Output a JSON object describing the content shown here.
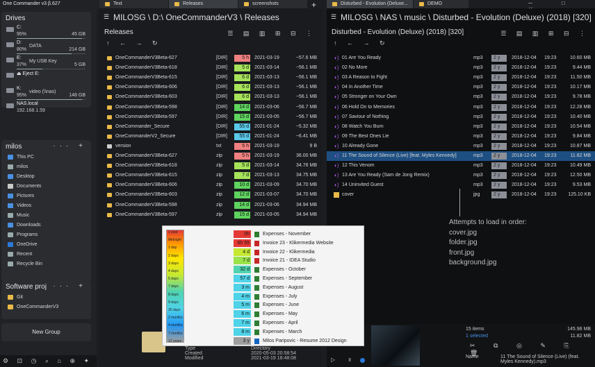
{
  "app": {
    "title": "One Commander v3 β.627"
  },
  "drives": {
    "title": "Drives",
    "items": [
      {
        "name": "C:",
        "pct": "95%",
        "label": "",
        "size": "45 GB",
        "fill": 0.95
      },
      {
        "name": "D:",
        "pct": "80%",
        "label": "DATA",
        "size": "214 GB",
        "fill": 0.8
      },
      {
        "name": "E:",
        "pct": "37%",
        "label": "My USB Key",
        "size": "5 GB",
        "fill": 0.37
      },
      {
        "name": "⏏ Eject E:",
        "pct": "",
        "label": "",
        "size": "",
        "fill": 0
      },
      {
        "name": "K:",
        "pct": "95%",
        "label": "video (\\\\nas)",
        "size": "148 GB",
        "fill": 0.95
      },
      {
        "name": "NAS.local",
        "pct": "192.168.1.59",
        "label": "",
        "size": "",
        "fill": 0
      }
    ]
  },
  "favorites": {
    "title": "milos",
    "items": [
      "This PC",
      "milos",
      "Desktop",
      "Documents",
      "Pictures",
      "Videos",
      "Music",
      "Downloads",
      "Programs",
      "OneDrive",
      "Recent",
      "Recycle Bin"
    ]
  },
  "projects": {
    "title": "Software proj",
    "items": [
      "Git",
      "OneCommanderV3"
    ],
    "new_group": "New Group"
  },
  "tabs_left": [
    {
      "label": "Text"
    },
    {
      "label": "Releases"
    },
    {
      "label": "screenshots"
    }
  ],
  "tabs_right": [
    {
      "label": "Disturbed - Evolution (Deluxe..."
    },
    {
      "label": "DEMO"
    }
  ],
  "left": {
    "breadcrumb": "MILOSG \\ D:\\ OneCommanderV3 \\ Releases",
    "title": "Releases",
    "rows": [
      {
        "name": "OneCommanderV3Beta-627",
        "type": "[DIR]",
        "age": "5 h",
        "age_color": "#f08080",
        "date": "2021-03-19",
        "size": "~57.6 MB",
        "icon": "#e9b949"
      },
      {
        "name": "OneCommanderV3Beta-618",
        "type": "[DIR]",
        "age": "5 d",
        "age_color": "#a6e35a",
        "date": "2021-03-14",
        "size": "~56.1 MB",
        "icon": "#e9b949"
      },
      {
        "name": "OneCommanderV3Beta-615",
        "type": "[DIR]",
        "age": "6 d",
        "age_color": "#a6e35a",
        "date": "2021-03-13",
        "size": "~56.1 MB",
        "icon": "#e9b949"
      },
      {
        "name": "OneCommanderV3Beta-606",
        "type": "[DIR]",
        "age": "6 d",
        "age_color": "#a6e35a",
        "date": "2021-03-13",
        "size": "~56.1 MB",
        "icon": "#e9b949"
      },
      {
        "name": "OneCommanderV3Beta-603",
        "type": "[DIR]",
        "age": "6 d",
        "age_color": "#a6e35a",
        "date": "2021-03-13",
        "size": "~56.1 MB",
        "icon": "#e9b949"
      },
      {
        "name": "OneCommanderV3Beta-598",
        "type": "[DIR]",
        "age": "14 d",
        "age_color": "#5fd35f",
        "date": "2021-03-06",
        "size": "~56.7 MB",
        "icon": "#e9b949"
      },
      {
        "name": "OneCommanderV3Beta-597",
        "type": "[DIR]",
        "age": "15 d",
        "age_color": "#5fd35f",
        "date": "2021-03-05",
        "size": "~56.7 MB",
        "icon": "#e9b949"
      },
      {
        "name": "OneCommander_Secure",
        "type": "[DIR]",
        "age": "55 d",
        "age_color": "#5ac8e8",
        "date": "2021-01-24",
        "size": "~5.32 MB",
        "icon": "#e9b949"
      },
      {
        "name": "OneCommanderV2_Secure",
        "type": "[DIR]",
        "age": "55 d",
        "age_color": "#5ac8e8",
        "date": "2021-01-24",
        "size": "~6.41 MB",
        "icon": "#e9b949"
      },
      {
        "name": "version",
        "type": "txt",
        "age": "5 h",
        "age_color": "#f08080",
        "date": "2021-03-19",
        "size": "9 B",
        "icon": "#cccccc"
      },
      {
        "name": "OneCommanderV3Beta-627",
        "type": "zip",
        "age": "5 h",
        "age_color": "#f08080",
        "date": "2021-03-19",
        "size": "36.00 MB",
        "icon": "#e9b949"
      },
      {
        "name": "OneCommanderV3Beta-618",
        "type": "zip",
        "age": "5 d",
        "age_color": "#a6e35a",
        "date": "2021-03-14",
        "size": "34.76 MB",
        "icon": "#e9b949"
      },
      {
        "name": "OneCommanderV3Beta-615",
        "type": "zip",
        "age": "7 d",
        "age_color": "#a6e35a",
        "date": "2021-03-13",
        "size": "34.75 MB",
        "icon": "#e9b949"
      },
      {
        "name": "OneCommanderV3Beta-606",
        "type": "zip",
        "age": "10 d",
        "age_color": "#5fd35f",
        "date": "2021-03-09",
        "size": "34.70 MB",
        "icon": "#e9b949"
      },
      {
        "name": "OneCommanderV3Beta-603",
        "type": "zip",
        "age": "12 d",
        "age_color": "#5fd35f",
        "date": "2021-03-07",
        "size": "34.70 MB",
        "icon": "#e9b949"
      },
      {
        "name": "OneCommanderV3Beta-598",
        "type": "zip",
        "age": "14 d",
        "age_color": "#5fd35f",
        "date": "2021-03-06",
        "size": "34.94 MB",
        "icon": "#e9b949"
      },
      {
        "name": "OneCommanderV3Beta-597",
        "type": "zip",
        "age": "15 d",
        "age_color": "#5fd35f",
        "date": "2021-03-05",
        "size": "34.94 MB",
        "icon": "#e9b949"
      }
    ],
    "props": {
      "type_label": "Type",
      "created_label": "Created",
      "modified_label": "Modified",
      "directory_label": "Directory",
      "created": "2020-05-03 20:58:54",
      "modified": "2021-03-19 18:48:08"
    }
  },
  "popup": {
    "scale": [
      "1 year",
      "Midnight",
      "1 day",
      "2 days",
      "3 days",
      "4 days",
      "5 days",
      "7 days",
      "8 days",
      "9 days",
      "30 days",
      "2 months",
      "4 months",
      "7 months",
      "12 years"
    ],
    "rows": [
      {
        "age": "0h",
        "age_color": "#e53935",
        "name": "Expenses - November",
        "icon": "#2e7d32"
      },
      {
        "age": "6h 55",
        "age_color": "#e53935",
        "name": "Invoice 23 - Klikermedia Website",
        "icon": "#c62828"
      },
      {
        "age": "4 d",
        "age_color": "#c6e832",
        "name": "Invoice 22 - Klikermedia",
        "icon": "#c62828"
      },
      {
        "age": "7 d",
        "age_color": "#9be34a",
        "name": "Invoice 21 - IDEA Studio",
        "icon": "#c62828"
      },
      {
        "age": "32 d",
        "age_color": "#4fd3b0",
        "name": "Expenses - October",
        "icon": "#2e7d32"
      },
      {
        "age": "57 d",
        "age_color": "#4fd3e8",
        "name": "Expenses - September",
        "icon": "#2e7d32"
      },
      {
        "age": "3 m",
        "age_color": "#4fd3e8",
        "name": "Expenses - August",
        "icon": "#2e7d32"
      },
      {
        "age": "4 m",
        "age_color": "#4fd3e8",
        "name": "Expenses - July",
        "icon": "#2e7d32"
      },
      {
        "age": "5 m",
        "age_color": "#4fd3e8",
        "name": "Expenses - June",
        "icon": "#2e7d32"
      },
      {
        "age": "6 m",
        "age_color": "#4fd3e8",
        "name": "Expenses - May",
        "icon": "#2e7d32"
      },
      {
        "age": "7 m",
        "age_color": "#4fd3e8",
        "name": "Expenses - April",
        "icon": "#2e7d32"
      },
      {
        "age": "8 m",
        "age_color": "#4fd3e8",
        "name": "Expenses - March",
        "icon": "#2e7d32"
      },
      {
        "age": "3 y",
        "age_color": "#9e9e9e",
        "name": "Milos Paripovic - Resume 2012 Design",
        "icon": "#1565c0"
      }
    ]
  },
  "right": {
    "breadcrumb": "MILOSG \\ NAS \\ music \\ Disturbed - Evolution (Deluxe) (2018) [320]",
    "title": "Disturbed - Evolution (Deluxe) (2018) [320]",
    "rows": [
      {
        "name": "01 Are You Ready",
        "type": "mp3",
        "age": "2 y",
        "date": "2018-12-04",
        "time": "19:23",
        "size": "10.60 MB"
      },
      {
        "name": "02 No More",
        "type": "mp3",
        "age": "2 y",
        "date": "2018-12-04",
        "time": "19:23",
        "size": "9.44 MB"
      },
      {
        "name": "03 A Reason to Fight",
        "type": "mp3",
        "age": "2 y",
        "date": "2018-12-04",
        "time": "19:23",
        "size": "11.50 MB"
      },
      {
        "name": "04 In Another Time",
        "type": "mp3",
        "age": "2 y",
        "date": "2018-12-04",
        "time": "19:23",
        "size": "10.17 MB"
      },
      {
        "name": "05 Stronger on Your Own",
        "type": "mp3",
        "age": "2 y",
        "date": "2018-12-04",
        "time": "19:23",
        "size": "9.78 MB"
      },
      {
        "name": "06 Hold On to Memories",
        "type": "mp3",
        "age": "2 y",
        "date": "2018-12-04",
        "time": "19:23",
        "size": "12.28 MB"
      },
      {
        "name": "07 Saviour of Nothing",
        "type": "mp3",
        "age": "2 y",
        "date": "2018-12-04",
        "time": "19:23",
        "size": "10.40 MB"
      },
      {
        "name": "08 Watch You Burn",
        "type": "mp3",
        "age": "2 y",
        "date": "2018-12-04",
        "time": "19:23",
        "size": "10.54 MB"
      },
      {
        "name": "09 The Best Ones Lie",
        "type": "mp3",
        "age": "2 y",
        "date": "2018-12-04",
        "time": "19:23",
        "size": "9.84 MB"
      },
      {
        "name": "10 Already Gone",
        "type": "mp3",
        "age": "2 y",
        "date": "2018-12-04",
        "time": "19:23",
        "size": "10.87 MB"
      },
      {
        "name": "11 The Sound of Silence (Live) [feat. Myles Kennedy]",
        "type": "mp3",
        "age": "2 y",
        "date": "2018-12-04",
        "time": "19:23",
        "size": "11.82 MB",
        "selected": true
      },
      {
        "name": "12 This Venom",
        "type": "mp3",
        "age": "2 y",
        "date": "2018-12-04",
        "time": "19:23",
        "size": "10.49 MB"
      },
      {
        "name": "13 Are You Ready (Sam de Jong Remix)",
        "type": "mp3",
        "age": "2 y",
        "date": "2018-12-04",
        "time": "19:23",
        "size": "12.50 MB"
      },
      {
        "name": "14 Uninvited Guest",
        "type": "mp3",
        "age": "2 y",
        "date": "2018-12-04",
        "time": "19:23",
        "size": "9.53 MB"
      },
      {
        "name": "cover",
        "type": "jpg",
        "age": "2 y",
        "date": "2018-12-04",
        "time": "19:23",
        "size": "125.10 KB",
        "image": true
      }
    ],
    "notes": [
      "Attempts to load in order:",
      "cover.jpg",
      "folder.jpg",
      "front.jpg",
      "background.jpg"
    ],
    "status": {
      "items": "15 items",
      "selected": "1 selected",
      "total": "145.98 MB",
      "sel_size": "11.82 MB",
      "name_label": "Name",
      "name_value": "11 The Sound of Silence (Live) (feat. Myles Kennedy).mp3"
    }
  }
}
